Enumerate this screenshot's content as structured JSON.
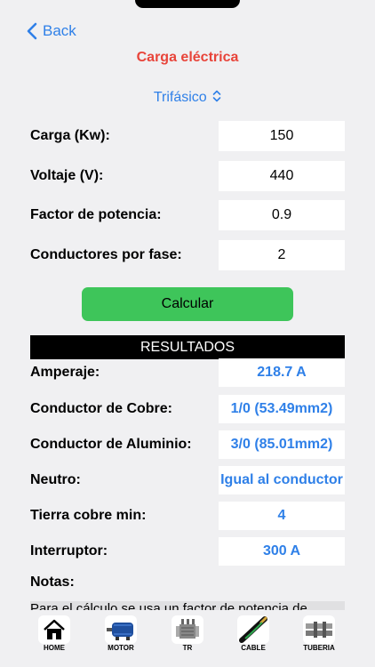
{
  "nav": {
    "back_label": "Back"
  },
  "header": {
    "title": "Carga eléctrica"
  },
  "mode": {
    "selected": "Trifásico"
  },
  "inputs": [
    {
      "label": "Carga (Kw):",
      "value": "150"
    },
    {
      "label": "Voltaje (V):",
      "value": "440"
    },
    {
      "label": "Factor de potencia:",
      "value": "0.9"
    },
    {
      "label": "Conductores por fase:",
      "value": "2"
    }
  ],
  "calculate_label": "Calcular",
  "results_header": "RESULTADOS",
  "results": [
    {
      "label": "Amperaje:",
      "value": "218.7 A"
    },
    {
      "label": "Conductor de Cobre:",
      "value": "1/0 (53.49mm2)"
    },
    {
      "label": "Conductor de Aluminio:",
      "value": "3/0 (85.01mm2)"
    },
    {
      "label": "Neutro:",
      "value": "Igual al conductor"
    },
    {
      "label": "Tierra cobre min:",
      "value": "4"
    },
    {
      "label": "Interruptor:",
      "value": "300 A"
    }
  ],
  "notes": {
    "label": "Notas:",
    "text": "Para el cálculo se usa un factor de potencia de"
  },
  "tabs": [
    {
      "label": "HOME",
      "icon": "home-icon"
    },
    {
      "label": "MOTOR",
      "icon": "motor-icon"
    },
    {
      "label": "TR",
      "icon": "transformer-icon"
    },
    {
      "label": "CABLE",
      "icon": "cable-icon"
    },
    {
      "label": "TUBERIA",
      "icon": "pipe-icon"
    }
  ],
  "colors": {
    "accent": "#2f80e8",
    "title": "#e8443a",
    "button": "#3ec55a",
    "background": "#f0f0f2"
  }
}
